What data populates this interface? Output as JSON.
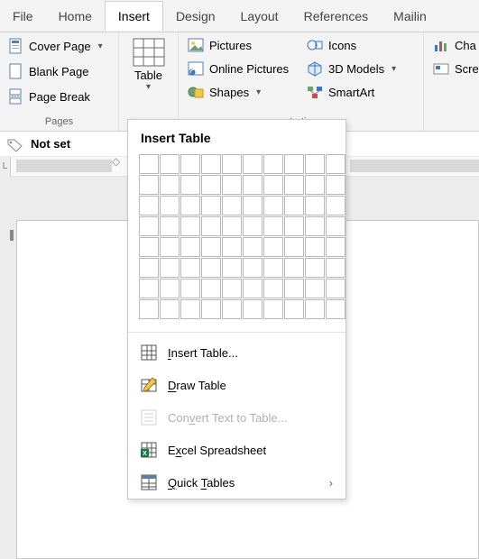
{
  "tabs": [
    "File",
    "Home",
    "Insert",
    "Design",
    "Layout",
    "References",
    "Mailin"
  ],
  "activeTab": "Insert",
  "ribbon": {
    "pages": {
      "label": "Pages",
      "items": [
        {
          "label": "Cover Page",
          "hasDropdown": true
        },
        {
          "label": "Blank Page",
          "hasDropdown": false
        },
        {
          "label": "Page Break",
          "hasDropdown": false
        }
      ]
    },
    "table": {
      "label": "Table"
    },
    "illustrations": {
      "label": "ustrations",
      "items": [
        {
          "label": "Pictures"
        },
        {
          "label": "Online Pictures"
        },
        {
          "label": "Shapes",
          "hasDropdown": true
        },
        {
          "label": "Icons"
        },
        {
          "label": "3D Models",
          "hasDropdown": true
        },
        {
          "label": "SmartArt"
        }
      ]
    },
    "charts": {
      "items": [
        {
          "label": "Cha"
        },
        {
          "label": "Scre"
        }
      ]
    }
  },
  "tagbar": {
    "text": "Not set"
  },
  "ruler": {
    "leftLabel": "L"
  },
  "dropdown": {
    "title": "Insert Table",
    "grid": {
      "cols": 10,
      "rows": 8
    },
    "items": [
      {
        "key": "insert",
        "label_pre": "",
        "label_u": "I",
        "label_post": "nsert Table...",
        "enabled": true
      },
      {
        "key": "draw",
        "label_pre": "",
        "label_u": "D",
        "label_post": "raw Table",
        "enabled": true
      },
      {
        "key": "convert",
        "label_pre": "Con",
        "label_u": "v",
        "label_post": "ert Text to Table...",
        "enabled": false
      },
      {
        "key": "excel",
        "label_pre": "E",
        "label_u": "x",
        "label_post": "cel Spreadsheet",
        "enabled": true
      },
      {
        "key": "quick",
        "label_pre": "",
        "label_u": "Q",
        "label_post": "uick ",
        "label2_u": "T",
        "label2_post": "ables",
        "enabled": true,
        "submenu": true
      }
    ]
  }
}
